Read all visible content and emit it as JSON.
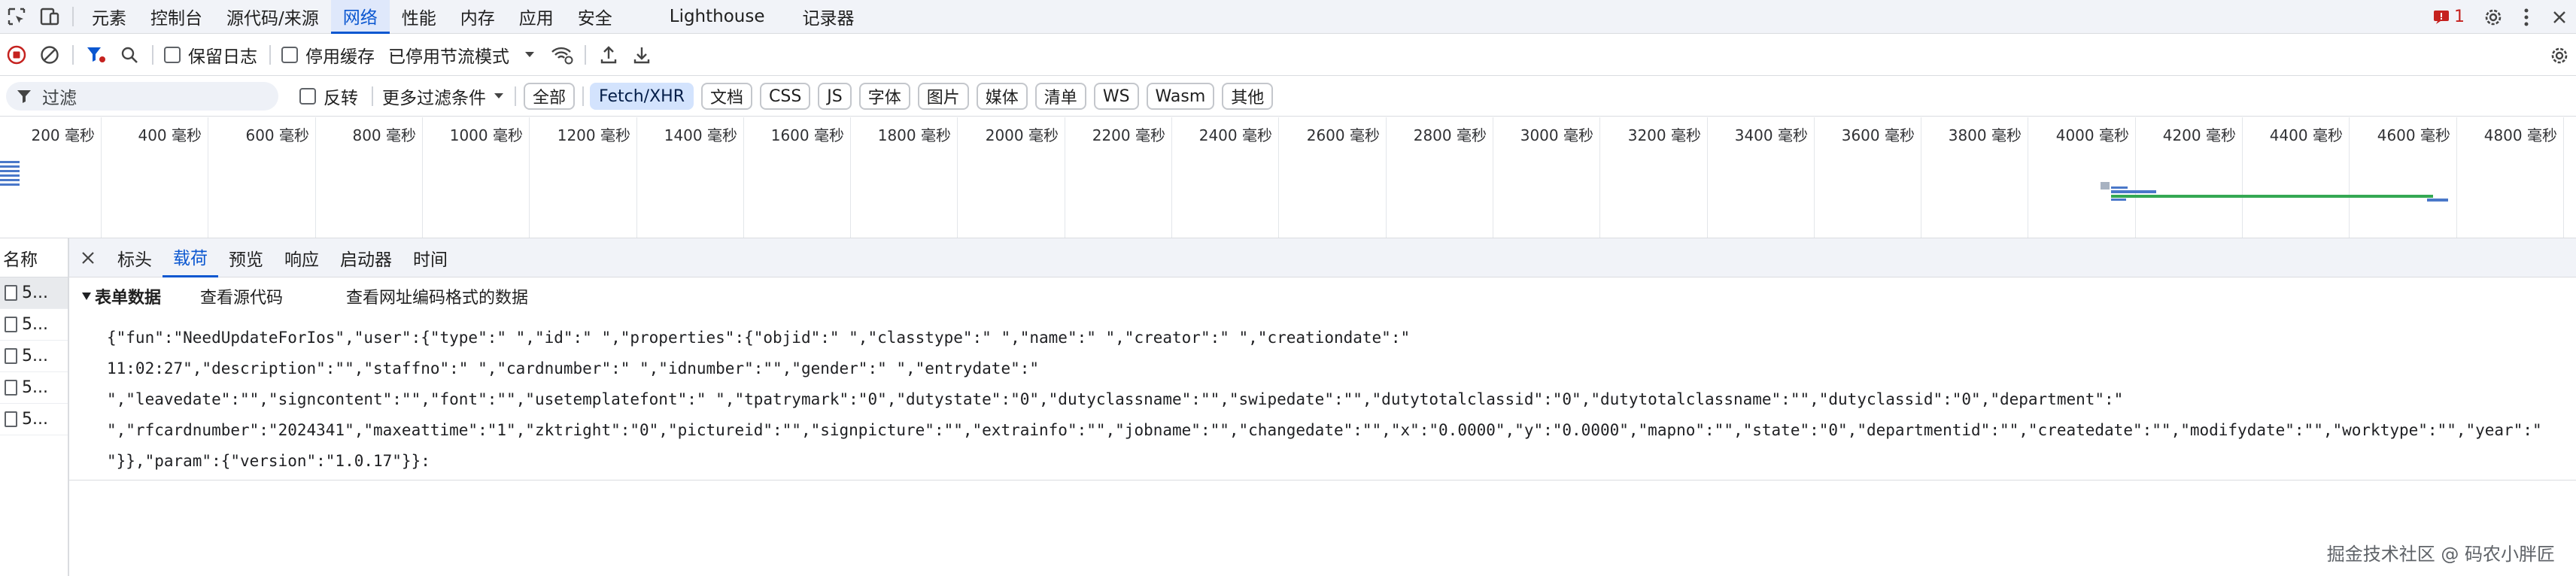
{
  "tabs": {
    "elements": "元素",
    "console": "控制台",
    "sources": "源代码/来源",
    "network": "网络",
    "performance": "性能",
    "memory": "内存",
    "application": "应用",
    "security": "安全",
    "lighthouse": "Lighthouse",
    "recorder": "记录器"
  },
  "issues_count": "1",
  "toolbar": {
    "preserve_log": "保留日志",
    "disable_cache": "停用缓存",
    "throttle": "已停用节流模式"
  },
  "filter": {
    "placeholder": "过滤",
    "invert": "反转",
    "more_filters": "更多过滤条件",
    "types": [
      "全部",
      "Fetch/XHR",
      "文档",
      "CSS",
      "JS",
      "字体",
      "图片",
      "媒体",
      "清单",
      "WS",
      "Wasm",
      "其他"
    ],
    "selected_type": "Fetch/XHR"
  },
  "timeline": {
    "ticks": [
      "200 毫秒",
      "400 毫秒",
      "600 毫秒",
      "800 毫秒",
      "1000 毫秒",
      "1200 毫秒",
      "1400 毫秒",
      "1600 毫秒",
      "1800 毫秒",
      "2000 毫秒",
      "2200 毫秒",
      "2400 毫秒",
      "2600 毫秒",
      "2800 毫秒",
      "3000 毫秒",
      "3200 毫秒",
      "3400 毫秒",
      "3600 毫秒",
      "3800 毫秒",
      "4000 毫秒",
      "4200 毫秒",
      "4400 毫秒",
      "4600 毫秒",
      "4800 毫秒"
    ]
  },
  "requests": {
    "header": "名称",
    "items": [
      "5...",
      "5...",
      "5...",
      "5...",
      "5..."
    ]
  },
  "detail": {
    "tabs": [
      "标头",
      "载荷",
      "预览",
      "响应",
      "启动器",
      "时间"
    ],
    "active_tab": "载荷",
    "section_title": "表单数据",
    "view_source": "查看源代码",
    "view_url_encoded": "查看网址编码格式的数据",
    "payload_lines": [
      "{\"fun\":\"NeedUpdateForIos\",\"user\":{\"type\":\"        \",\"id\":\"    \",\"properties\":{\"objid\":\"     \",\"classtype\":\"        \",\"name\":\"   \",\"creator\":\"     \",\"creationdate\":\"",
      "11:02:27\",\"description\":\"\",\"staffno\":\"     \",\"cardnumber\":\"          \",\"idnumber\":\"\",\"gender\":\"  \",\"entrydate\":\"",
      "  \",\"leavedate\":\"\",\"signcontent\":\"\",\"font\":\"\",\"usetemplatefont\":\"    \",\"tpatrymark\":\"0\",\"dutystate\":\"0\",\"dutyclassname\":\"\",\"swipedate\":\"\",\"dutytotalclassid\":\"0\",\"dutytotalclassname\":\"\",\"dutyclassid\":\"0\",\"department\":\"",
      " \",\"rfcardnumber\":\"2024341\",\"maxeattime\":\"1\",\"zktright\":\"0\",\"pictureid\":\"\",\"signpicture\":\"\",\"extrainfo\":\"\",\"jobname\":\"\",\"changedate\":\"\",\"x\":\"0.0000\",\"y\":\"0.0000\",\"mapno\":\"\",\"state\":\"0\",\"departmentid\":\"\",\"createdate\":\"\",\"modifydate\":\"\",\"worktype\":\"\",\"year\":\"",
      "  \"}},\"param\":{\"version\":\"1.0.17\"}}:"
    ]
  },
  "watermark": "掘金技术社区 @ 码农小胖匠",
  "colors": {
    "accent": "#0b57d0",
    "record_red": "#c5221f",
    "tab_bg": "#f1f3f8",
    "chip_selected": "#d3e3fd"
  }
}
